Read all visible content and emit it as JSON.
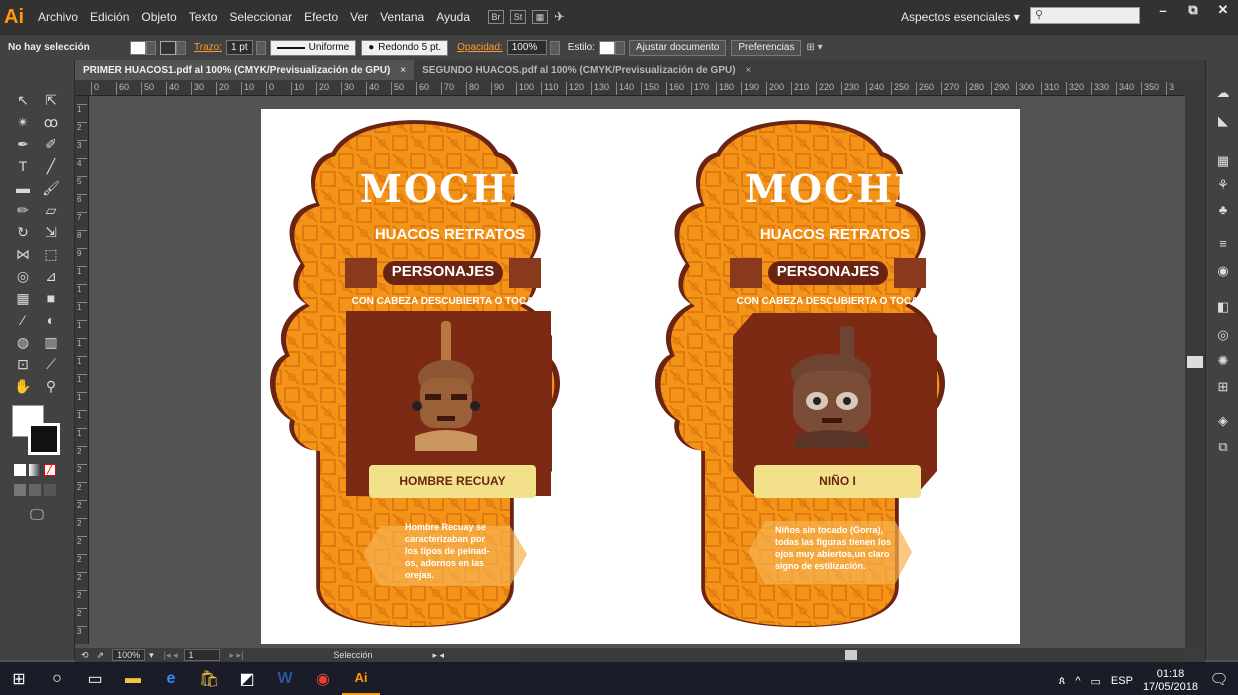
{
  "app": {
    "logo": "Ai",
    "workspace_label": "Aspectos esenciales"
  },
  "menu": [
    "Archivo",
    "Edición",
    "Objeto",
    "Texto",
    "Seleccionar",
    "Efecto",
    "Ver",
    "Ventana",
    "Ayuda"
  ],
  "menubar_icons": {
    "br": "Br",
    "st": "St"
  },
  "window_controls": {
    "minimize": "–",
    "maximize": "⧉",
    "close": "✕"
  },
  "control_bar": {
    "selection_label": "No hay selección",
    "stroke_label": "Trazo:",
    "stroke_value": "1 pt",
    "profile": "Uniforme",
    "brush": "Redondo 5 pt.",
    "opacity_label": "Opacidad:",
    "opacity_value": "100%",
    "style_label": "Estilo:",
    "fit_button": "Ajustar documento",
    "prefs_button": "Preferencias"
  },
  "tabs": [
    {
      "label": "PRIMER HUACOS1.pdf al 100% (CMYK/Previsualización de GPU)",
      "close": "×"
    },
    {
      "label": "SEGUNDO HUACOS.pdf al 100% (CMYK/Previsualización de GPU)",
      "close": "×"
    }
  ],
  "ruler_h": [
    "0",
    "60",
    "50",
    "40",
    "30",
    "20",
    "10",
    "0",
    "10",
    "20",
    "30",
    "40",
    "50",
    "60",
    "70",
    "80",
    "90",
    "100",
    "110",
    "120",
    "130",
    "140",
    "150",
    "160",
    "170",
    "180",
    "190",
    "200",
    "210",
    "220",
    "230",
    "240",
    "250",
    "260",
    "270",
    "280",
    "290",
    "300",
    "310",
    "320",
    "330",
    "340",
    "350",
    "3"
  ],
  "ruler_v": [
    "1",
    "2",
    "3",
    "4",
    "5",
    "6",
    "7",
    "8",
    "9",
    "1",
    "1",
    "1",
    "1",
    "1",
    "1",
    "1",
    "1",
    "1",
    "1",
    "2",
    "2",
    "2",
    "2",
    "2",
    "2",
    "2",
    "2",
    "2",
    "2",
    "3"
  ],
  "huacos": [
    {
      "title": "MOCHE",
      "subtitle": "HUACOS RETRATOS",
      "banner": "PERSONAJES",
      "tagline": "CON CABEZA DESCUBIERTA O TOCADO",
      "name": "HOMBRE RECUAY",
      "description": "Hombre Recuay se caracterizaban por los tipos de peinad-os, adornos en las orejas."
    },
    {
      "title": "MOCHE",
      "subtitle": "HUACOS RETRATOS",
      "banner": "PERSONAJES",
      "tagline": "CON CABEZA DESCUBIERTA O TOCADO",
      "name": "NIÑO I",
      "description": "Niños sin tocado (Gorra), todas las figuras tienen los ojos muy abiertos,un claro signo de estilización."
    }
  ],
  "status": {
    "zoom": "100%",
    "page": "1",
    "tool": "Selección"
  },
  "tray": {
    "lang": "ESP",
    "time": "01:18",
    "date": "17/05/2018"
  },
  "colors": {
    "orange": "#f39419",
    "dark_brown": "#6b2412",
    "maroon": "#7d2a15",
    "cream": "#f2e08a",
    "ui_dark": "#323232"
  }
}
